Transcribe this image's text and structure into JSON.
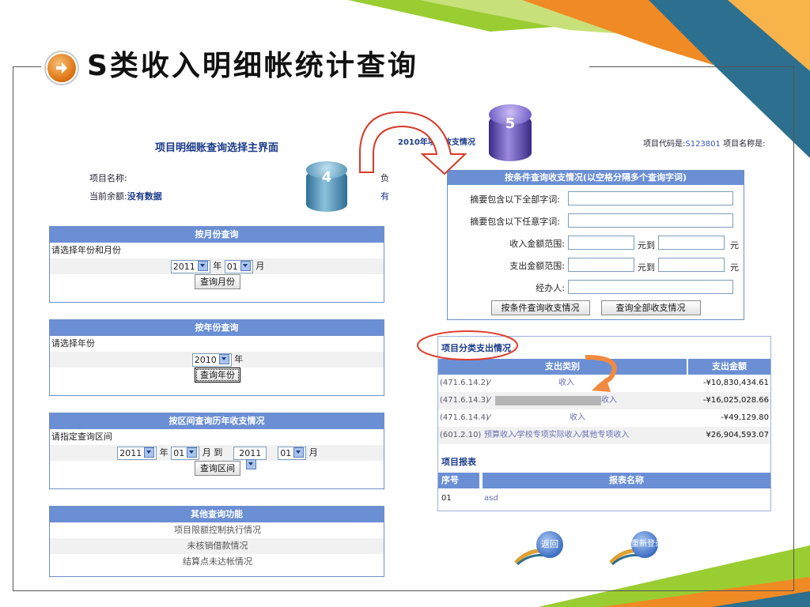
{
  "slide": {
    "title": "S类收入明细帐统计查询",
    "step_badges": [
      "4",
      "5"
    ]
  },
  "left": {
    "heading": "项目明细账查询选择主界面",
    "project_name_label": "项目名称:",
    "balance_label": "当前余额:",
    "balance_value": "没有数据",
    "partial_right_1": "负",
    "partial_right_2": "有",
    "by_month": {
      "header": "按月份查询",
      "prompt": "请选择年份和月份",
      "year": "2011",
      "year_unit": "年",
      "month": "01",
      "month_unit": "月",
      "button": "查询月份"
    },
    "by_year": {
      "header": "按年份查询",
      "prompt": "请选择年份",
      "year": "2010",
      "year_unit": "年",
      "button": "查询年份"
    },
    "by_range": {
      "header": "按区间查询历年收支情况",
      "prompt": "请指定查询区间",
      "from_year": "2011",
      "year_unit": "年",
      "from_month": "01",
      "month_unit": "月",
      "to": "到",
      "to_year": "2011",
      "to_month": "01",
      "to_month_unit": "月",
      "button": "查询区间"
    },
    "other": {
      "header": "其他查询功能",
      "links": [
        "项目限额控制执行情况",
        "未核销借款情况",
        "结算点未达帐情况"
      ]
    }
  },
  "right": {
    "top_title_partial": "2010年项目收支情况",
    "project_code_label": "项目代码是:",
    "project_code_value": "S123801",
    "project_name_label": "项目名称是:",
    "search": {
      "header": "按条件查询收支情况(以空格分隔多个查询字词)",
      "all_words_label": "摘要包含以下全部字词:",
      "any_words_label": "摘要包含以下任意字词:",
      "income_range_label": "收入金额范围:",
      "expense_range_label": "支出金额范围:",
      "to_label": "元到",
      "yuan": "元",
      "handler_label": "经办人:",
      "search_button": "按条件查询收支情况",
      "all_button": "查询全部收支情况"
    },
    "category": {
      "title": "项目分类支出情况",
      "col_category": "支出类别",
      "col_amount": "支出金额",
      "rows": [
        {
          "code": "(471.6.14.2)⁄",
          "category": "收入",
          "amount": "-¥10,830,434.61"
        },
        {
          "code": "(471.6.14.3)⁄",
          "category": "收入",
          "amount": "-¥16,025,028.66"
        },
        {
          "code": "(471.6.14.4)⁄",
          "category": "收入",
          "amount": "-¥49,129.80"
        },
        {
          "code": "(601.2.10)",
          "category": "预算收入⁄学校专项实际收入⁄其他专项收入",
          "amount": "¥26,904,593.07"
        }
      ]
    },
    "report": {
      "title": "项目报表",
      "col_no": "序号",
      "col_name": "报表名称",
      "rows": [
        {
          "no": "01",
          "name": "asd"
        }
      ]
    },
    "back_label": "返回",
    "relogin_label": "重新登录"
  }
}
